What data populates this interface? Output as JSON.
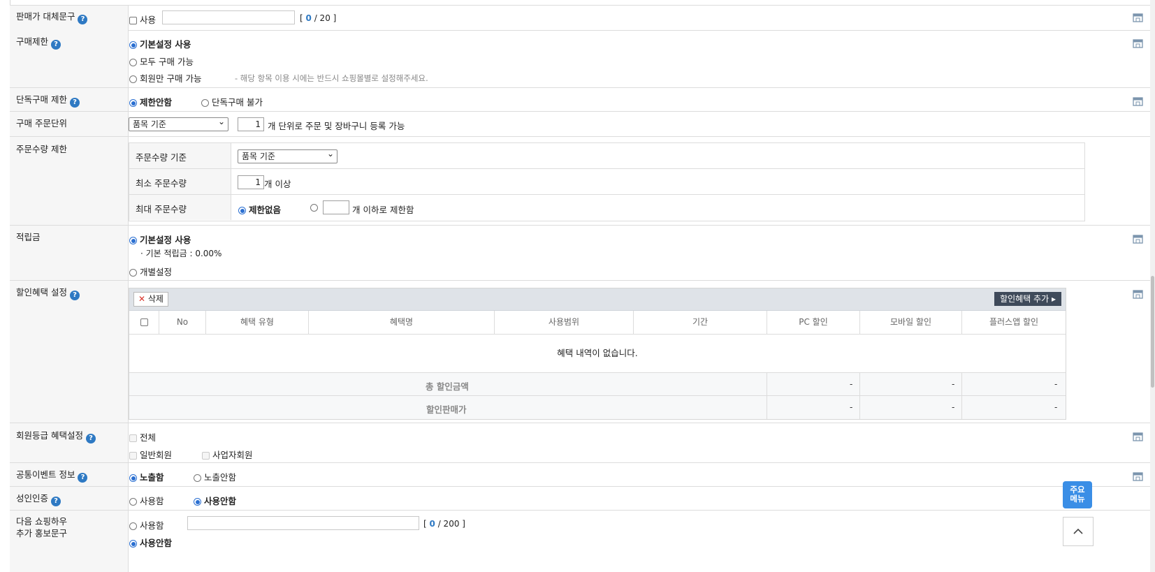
{
  "rows": {
    "price_replace": {
      "label": "판매가 대체문구",
      "use_label": "사용",
      "counter_open": "[",
      "counter_value": "0",
      "counter_sep": "/ 20",
      "counter_close": "]"
    },
    "purchase_limit": {
      "label": "구매제한",
      "opt1": "기본설정 사용",
      "opt2": "모두 구매 가능",
      "opt3": "회원만 구매 가능",
      "note": "- 해당 항목 이용 시에는 반드시 쇼핑몰별로 설정해주세요."
    },
    "single_limit": {
      "label": "단독구매 제한",
      "opt1": "제한안함",
      "opt2": "단독구매 불가"
    },
    "order_unit": {
      "label": "구매 주문단위",
      "select": "품목 기준",
      "qty": "1",
      "suffix": "개 단위로 주문 및 장바구니 등록 가능"
    },
    "order_qty": {
      "label": "주문수량 제한",
      "basis_label": "주문수량 기준",
      "basis_select": "품목 기준",
      "min_label": "최소 주문수량",
      "min_value": "1",
      "min_suffix": "개 이상",
      "max_label": "최대 주문수량",
      "max_opt1": "제한없음",
      "max_suffix": "개 이하로 제한함"
    },
    "points": {
      "label": "적립금",
      "opt1": "기본설정 사용",
      "basic_rate": "· 기본 적립금 : 0.00%",
      "opt2": "개별설정"
    },
    "discount": {
      "label": "할인혜택 설정",
      "delete_btn": "삭제",
      "add_btn": "할인혜택 추가",
      "columns": [
        "No",
        "혜택 유형",
        "혜택명",
        "사용범위",
        "기간",
        "PC 할인",
        "모바일 할인",
        "플러스앱 할인"
      ],
      "empty": "혜택 내역이 없습니다.",
      "total_label": "총 할인금액",
      "price_label": "할인판매가",
      "total_values": [
        "-",
        "-",
        "-"
      ],
      "price_values": [
        "-",
        "-",
        "-"
      ]
    },
    "member_grade": {
      "label": "회원등급 혜택설정",
      "all": "전체",
      "general": "일반회원",
      "business": "사업자회원"
    },
    "common_event": {
      "label": "공통이벤트 정보",
      "opt1": "노출함",
      "opt2": "노출안함"
    },
    "adult": {
      "label": "성인인증",
      "opt1": "사용함",
      "opt2": "사용안함"
    },
    "next_shop": {
      "label_line1": "다음 쇼핑하우",
      "label_line2": "추가 홍보문구",
      "opt1": "사용함",
      "opt2": "사용안함",
      "counter_open": "[",
      "counter_value": "0",
      "counter_sep": "/ 200",
      "counter_close": "]"
    }
  },
  "float_menu": {
    "line1": "주요",
    "line2": "메뉴"
  },
  "colors": {
    "accent": "#2e79c3",
    "radio": "#2a6fd1",
    "header_bg": "#f6f6f6",
    "dark_button": "#3f4a5a",
    "float_button": "#3a8ee6"
  }
}
